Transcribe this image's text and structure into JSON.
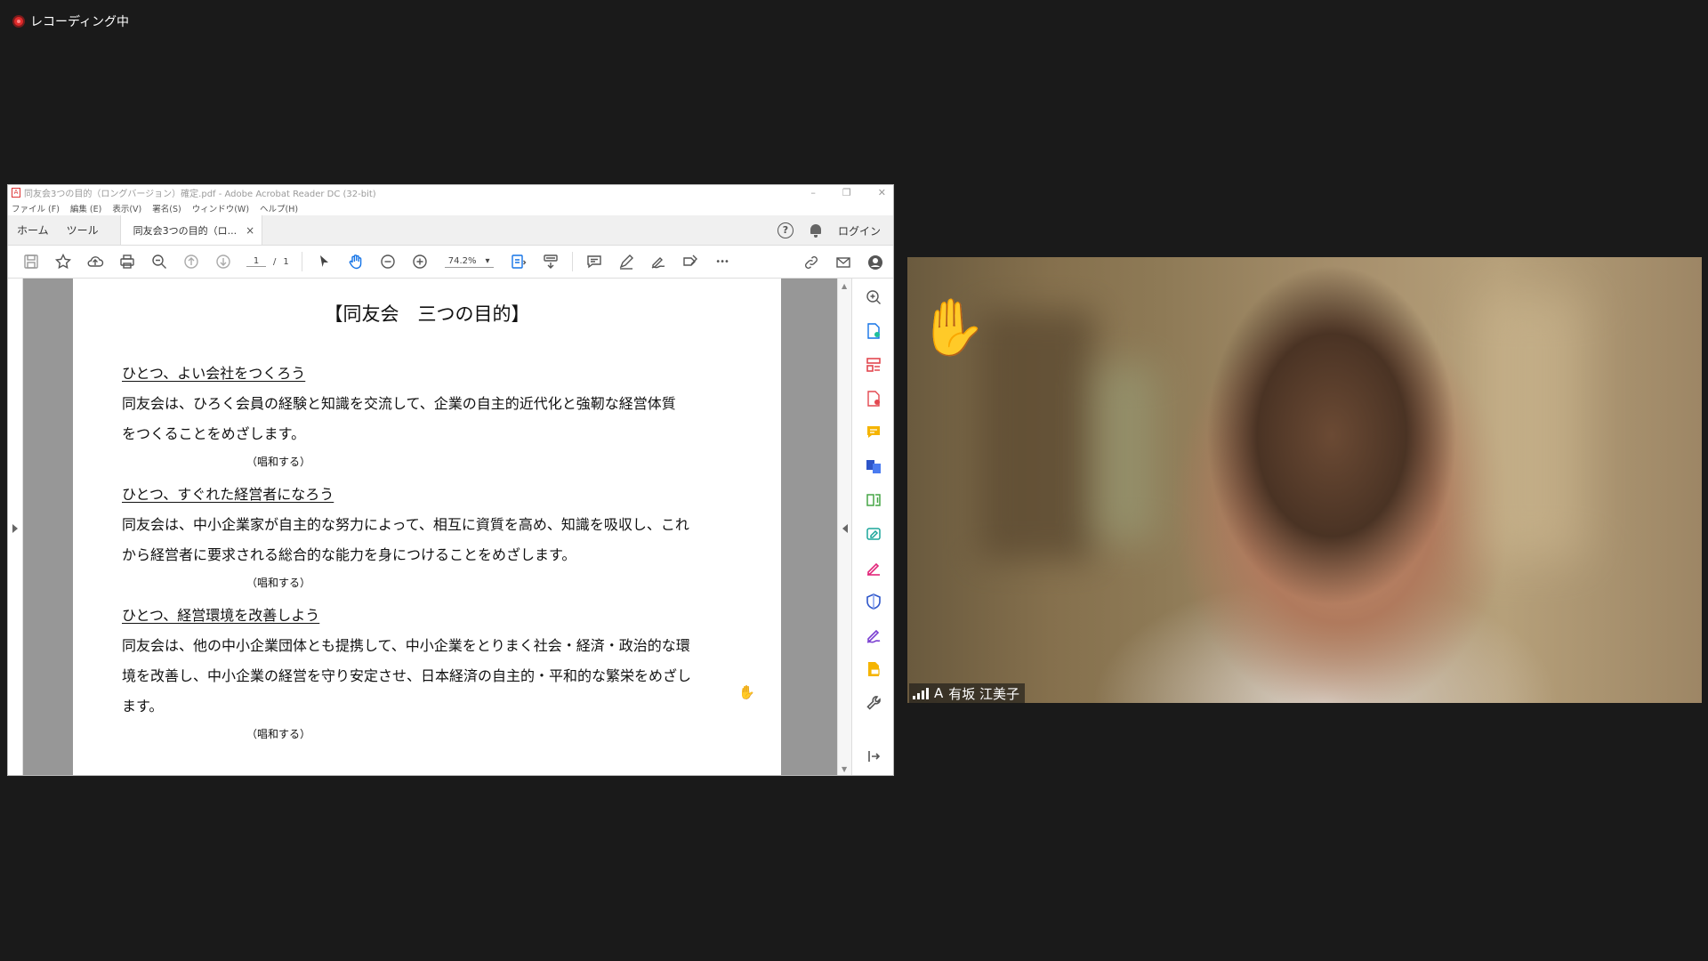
{
  "recording": {
    "label": "レコーディング中"
  },
  "window": {
    "title": "同友会3つの目的（ロングバージョン）確定.pdf - Adobe Acrobat Reader DC (32-bit)",
    "controls": {
      "minimize": "–",
      "restore": "❐",
      "close": "✕"
    }
  },
  "menu": [
    "ファイル (F)",
    "編集 (E)",
    "表示(V)",
    "署名(S)",
    "ウィンドウ(W)",
    "ヘルプ(H)"
  ],
  "tabs": {
    "home": "ホーム",
    "tools": "ツール",
    "document": "同友会3つの目的（ロ...",
    "close": "×",
    "help": "?",
    "login": "ログイン"
  },
  "toolbar": {
    "page_current": "1",
    "page_sep": "/",
    "page_total": "1",
    "zoom": "74.2%",
    "zoom_caret": "▾",
    "more": "•••"
  },
  "scroll": {
    "up": "▲",
    "down": "▼"
  },
  "pdf": {
    "title": "【同友会　三つの目的】",
    "sections": [
      {
        "heading": "ひとつ、よい会社をつくろう",
        "lines": [
          "同友会は、ひろく会員の経験と知識を交流して、企業の自主的近代化と強靭な経営体質",
          "をつくることをめざします。"
        ],
        "note": "（唱和する）"
      },
      {
        "heading": "ひとつ、すぐれた経営者になろう",
        "lines": [
          "同友会は、中小企業家が自主的な努力によって、相互に資質を高め、知識を吸収し、これ",
          "から経営者に要求される総合的な能力を身につけることをめざします。"
        ],
        "note": "（唱和する）"
      },
      {
        "heading": "ひとつ、経営環境を改善しよう",
        "lines": [
          "同友会は、他の中小企業団体とも提携して、中小企業をとりまく社会・経済・政治的な環",
          "境を改善し、中小企業の経営を守り安定させ、日本経済の自主的・平和的な繁栄をめざし",
          "ます。"
        ],
        "note": "（唱和する）"
      }
    ]
  },
  "video": {
    "participant_name": "有坂 江美子",
    "participant_prefix": "A",
    "reaction": "✋"
  },
  "colors": {
    "accent": "#1473e6",
    "recording": "#e02b2b",
    "viewer_gray": "#979797"
  }
}
